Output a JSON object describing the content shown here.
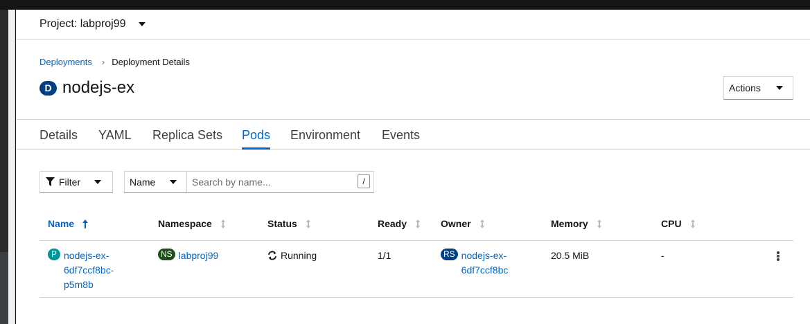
{
  "project": {
    "label": "Project: labproj99"
  },
  "breadcrumb": {
    "parent": "Deployments",
    "current": "Deployment Details"
  },
  "resource": {
    "badge": "D",
    "name": "nodejs-ex"
  },
  "actions": {
    "label": "Actions"
  },
  "tabs": [
    {
      "label": "Details"
    },
    {
      "label": "YAML"
    },
    {
      "label": "Replica Sets"
    },
    {
      "label": "Pods",
      "active": true
    },
    {
      "label": "Environment"
    },
    {
      "label": "Events"
    }
  ],
  "toolbar": {
    "filter_label": "Filter",
    "name_select": "Name",
    "search_placeholder": "Search by name...",
    "search_shortcut": "/"
  },
  "table": {
    "columns": [
      "Name",
      "Namespace",
      "Status",
      "Ready",
      "Owner",
      "Memory",
      "CPU"
    ],
    "rows": [
      {
        "name_badge": "P",
        "name": [
          "nodejs-ex-",
          "6df7ccf8bc-",
          "p5m8b"
        ],
        "namespace_badge": "NS",
        "namespace": "labproj99",
        "status": "Running",
        "ready": "1/1",
        "owner_badge": "RS",
        "owner": [
          "nodejs-ex-",
          "6df7ccf8bc"
        ],
        "memory": "20.5 MiB",
        "cpu": "-"
      }
    ]
  },
  "colors": {
    "link": "#0066cc",
    "deployment_badge": "#004080",
    "pod_badge": "#009596",
    "namespace_badge": "#1e4f18"
  },
  "icons": [
    "chevron-down-icon",
    "filter-icon",
    "sort-icon",
    "sync-icon",
    "kebab-icon"
  ]
}
